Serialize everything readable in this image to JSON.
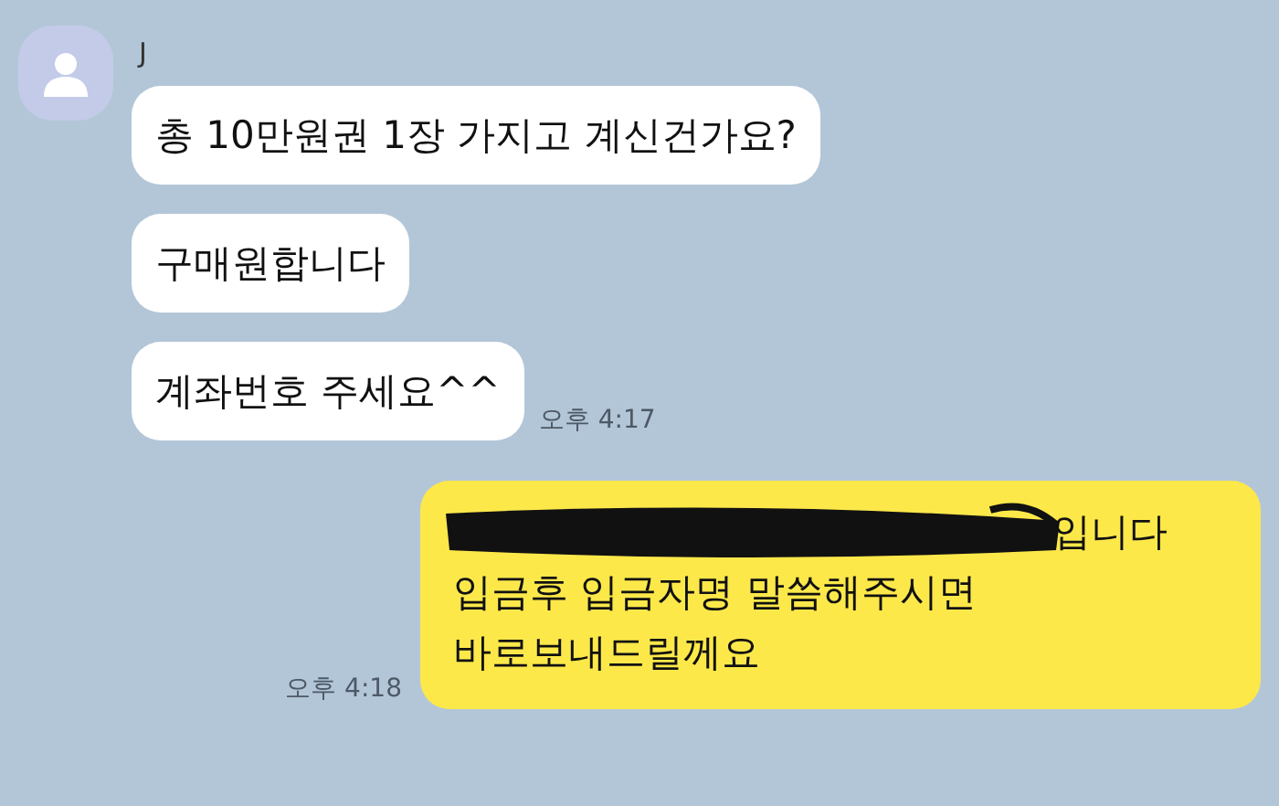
{
  "sender": {
    "name": "J"
  },
  "messages": [
    {
      "kind": "received",
      "text": "총 10만원권 1장 가지고 계신건가요?"
    },
    {
      "kind": "received",
      "text": "구매원합니다"
    },
    {
      "kind": "received",
      "text": "계좌번호 주세요^^",
      "time": "오후 4:17"
    },
    {
      "kind": "sent",
      "redacted": true,
      "text": "입니다\n입금후 입금자명 말씀해주시면\n바로보내드릴께요",
      "time": "오후 4:18"
    }
  ]
}
